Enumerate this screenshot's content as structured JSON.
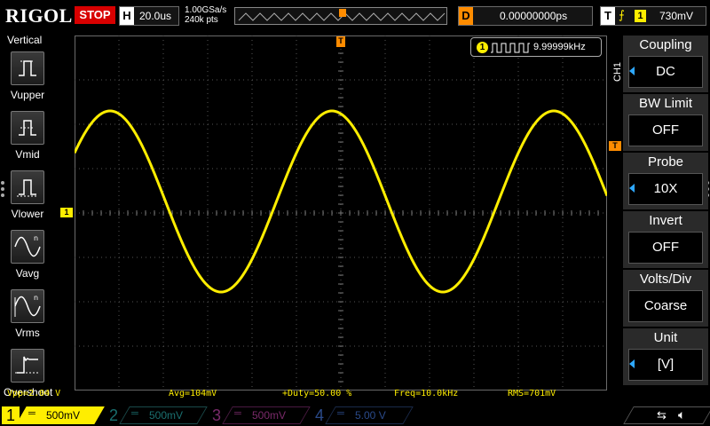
{
  "top": {
    "logo": "RIGOL",
    "run_state": "STOP",
    "horizontal_letter": "H",
    "timebase": "20.0us",
    "sample_rate": "1.00GSa/s",
    "memory_depth": "240k pts",
    "delay_letter": "D",
    "delay": "0.00000000ps",
    "trigger_letter": "T",
    "trigger_edge": "⨍",
    "trigger_source": "1",
    "trigger_level": "730mV"
  },
  "left_menu": {
    "title": "Vertical",
    "items": [
      {
        "label": "Vupper",
        "icon": "vupper-icon"
      },
      {
        "label": "Vmid",
        "icon": "vmid-icon"
      },
      {
        "label": "Vlower",
        "icon": "vlower-icon"
      },
      {
        "label": "Vavg",
        "icon": "vavg-icon"
      },
      {
        "label": "Vrms",
        "icon": "vrms-icon"
      },
      {
        "label": "Overshoot",
        "icon": "overshoot-icon"
      }
    ]
  },
  "markers": {
    "trigger_position": "T",
    "ch1_offset": "1",
    "trigger_level": "T"
  },
  "frequency_counter": {
    "channel": "1",
    "value": "9.99999kHz"
  },
  "measurements": {
    "vpp": "Vpp=2.04 V",
    "avg": "Avg=104mV",
    "duty": "+Duty=50.00 %",
    "freq": "Freq=10.0kHz",
    "rms": "RMS=701mV"
  },
  "right_menu": {
    "channel_tag": "CH1",
    "items": [
      {
        "title": "Coupling",
        "value": "DC"
      },
      {
        "title": "BW Limit",
        "value": "OFF"
      },
      {
        "title": "Probe",
        "value": "10X"
      },
      {
        "title": "Invert",
        "value": "OFF"
      },
      {
        "title": "Volts/Div",
        "value": "Coarse"
      },
      {
        "title": "Unit",
        "value": "[V]"
      }
    ]
  },
  "channels": [
    {
      "num": "1",
      "coupling": "═",
      "scale": "500mV"
    },
    {
      "num": "2",
      "coupling": "═",
      "scale": "500mV"
    },
    {
      "num": "3",
      "coupling": "═",
      "scale": "500mV"
    },
    {
      "num": "4",
      "coupling": "═",
      "scale": "5.00 V"
    }
  ],
  "status_icons": {
    "usb": "⇆",
    "speaker": "🔈︎"
  },
  "colors": {
    "ch1": "#ffee00",
    "ch2": "#1a6f6f",
    "ch3": "#7a2a6a",
    "ch4": "#2a4a8a",
    "trigger": "#ff8c00",
    "stop": "#d80000",
    "menu_arrow": "#2ea8ff"
  },
  "waveform": {
    "type": "sine",
    "channel": "1",
    "frequency_khz": 10,
    "vpp": 2.04,
    "v_per_div": 0.5,
    "us_per_div": 20,
    "offset_div": 0.26,
    "phase_first_max_us": 16
  }
}
